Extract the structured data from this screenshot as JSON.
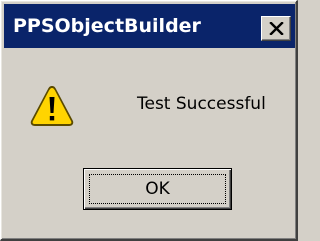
{
  "window": {
    "title": "PPSObjectBuilder"
  },
  "titlebar": {
    "close_icon": "close-icon"
  },
  "dialog": {
    "icon": "warning-icon",
    "message": "Test Successful",
    "ok_label": "OK"
  },
  "colors": {
    "titlebar": "#0a246a",
    "dialog_bg": "#d4d0c8",
    "warning_yellow": "#ffcc00"
  }
}
